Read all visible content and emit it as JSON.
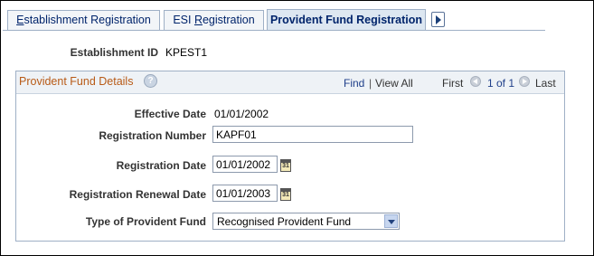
{
  "tabs": {
    "tab1_prefix": "",
    "tab1_accel": "E",
    "tab1_rest": "stablishment Registration",
    "tab2_prefix": "ESI ",
    "tab2_accel": "R",
    "tab2_rest": "egistration",
    "tab3": "Provident Fund Registration"
  },
  "establishment": {
    "label": "Establishment ID",
    "value": "KPEST1"
  },
  "group": {
    "title": "Provident Fund Details",
    "find": "Find",
    "separator": "|",
    "view_all": "View All",
    "first": "First",
    "count": "1 of 1",
    "last": "Last"
  },
  "fields": {
    "effective_date_label": "Effective Date",
    "effective_date_value": "01/01/2002",
    "registration_number_label": "Registration Number",
    "registration_number_value": "KAPF01",
    "registration_date_label": "Registration Date",
    "registration_date_value": "01/01/2002",
    "renewal_date_label": "Registration Renewal Date",
    "renewal_date_value": "01/01/2003",
    "type_label": "Type of Provident Fund",
    "type_value": "Recognised Provident Fund",
    "calendar_glyph": "31"
  },
  "colors": {
    "link": "#1f3f8a",
    "group_title": "#b85a16",
    "tab_active_bg": "#dde7f1"
  }
}
